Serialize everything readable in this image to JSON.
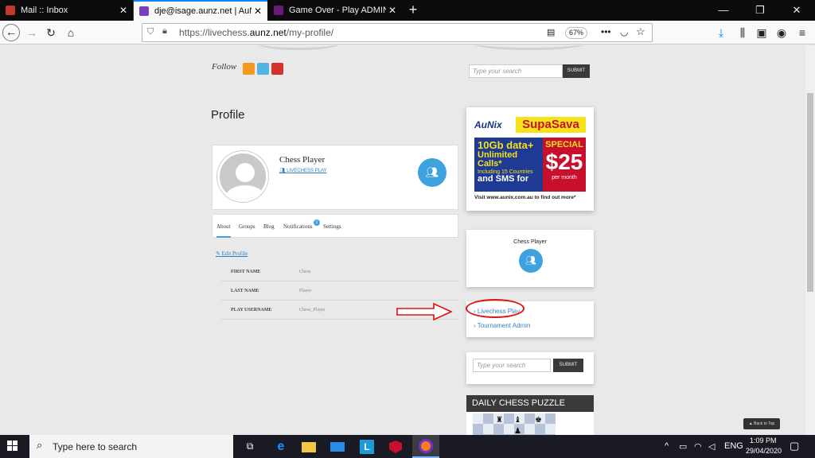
{
  "browser": {
    "tabs": [
      {
        "title": "Mail :: Inbox",
        "favicon": "mail-icon",
        "active": false
      },
      {
        "title": "dje@isage.aunz.net | AuNix Liv",
        "favicon": "aunix-icon",
        "active": true
      },
      {
        "title": "Game Over - Play ADMIN Davic",
        "favicon": "game-icon",
        "active": false
      }
    ],
    "url_prefix": "https://livechess.",
    "url_domain": "aunz.net",
    "url_path": "/my-profile/",
    "zoom": "67%"
  },
  "page": {
    "follow_label": "Follow",
    "search_placeholder": "Type your search",
    "submit_label": "SUBMIT",
    "heading": "Profile",
    "profile": {
      "name": "Chess Player",
      "group_link": "LIVECHESS PLAY"
    },
    "tabs": [
      "About",
      "Groups",
      "Blog",
      "Notifications",
      "Settings"
    ],
    "notification_count": "1",
    "edit_profile": "Edit Profile",
    "fields": [
      {
        "label": "FIRST NAME",
        "value": "Chess"
      },
      {
        "label": "LAST NAME",
        "value": "Player"
      },
      {
        "label": "PLAY USERNAME",
        "value": "Chess_Player"
      }
    ]
  },
  "ad": {
    "brand": "AuNix",
    "headline": "SupaSava",
    "line1": "10Gb data+",
    "line2": "Unlimited Calls*",
    "line3": "Including 15 Countries",
    "line4": "and SMS for",
    "special": "SPECIAL",
    "price": "$25",
    "per": "per month",
    "footer": "Visit www.aunix.com.au to find out more*"
  },
  "sidebar": {
    "widget_name": "Chess Player",
    "links": [
      "Livechess Play",
      "Tournament Admin"
    ],
    "search_placeholder": "Type your search",
    "submit_label": "SUBMIT",
    "puzzle_title": "DAILY CHESS PUZZLE",
    "back_to_top": "Back to Top"
  },
  "taskbar": {
    "search_placeholder": "Type here to search",
    "language": "ENG",
    "time": "1:09 PM",
    "date": "29/04/2020"
  },
  "colors": {
    "accent": "#3ea2de",
    "annotation": "#e01010"
  }
}
